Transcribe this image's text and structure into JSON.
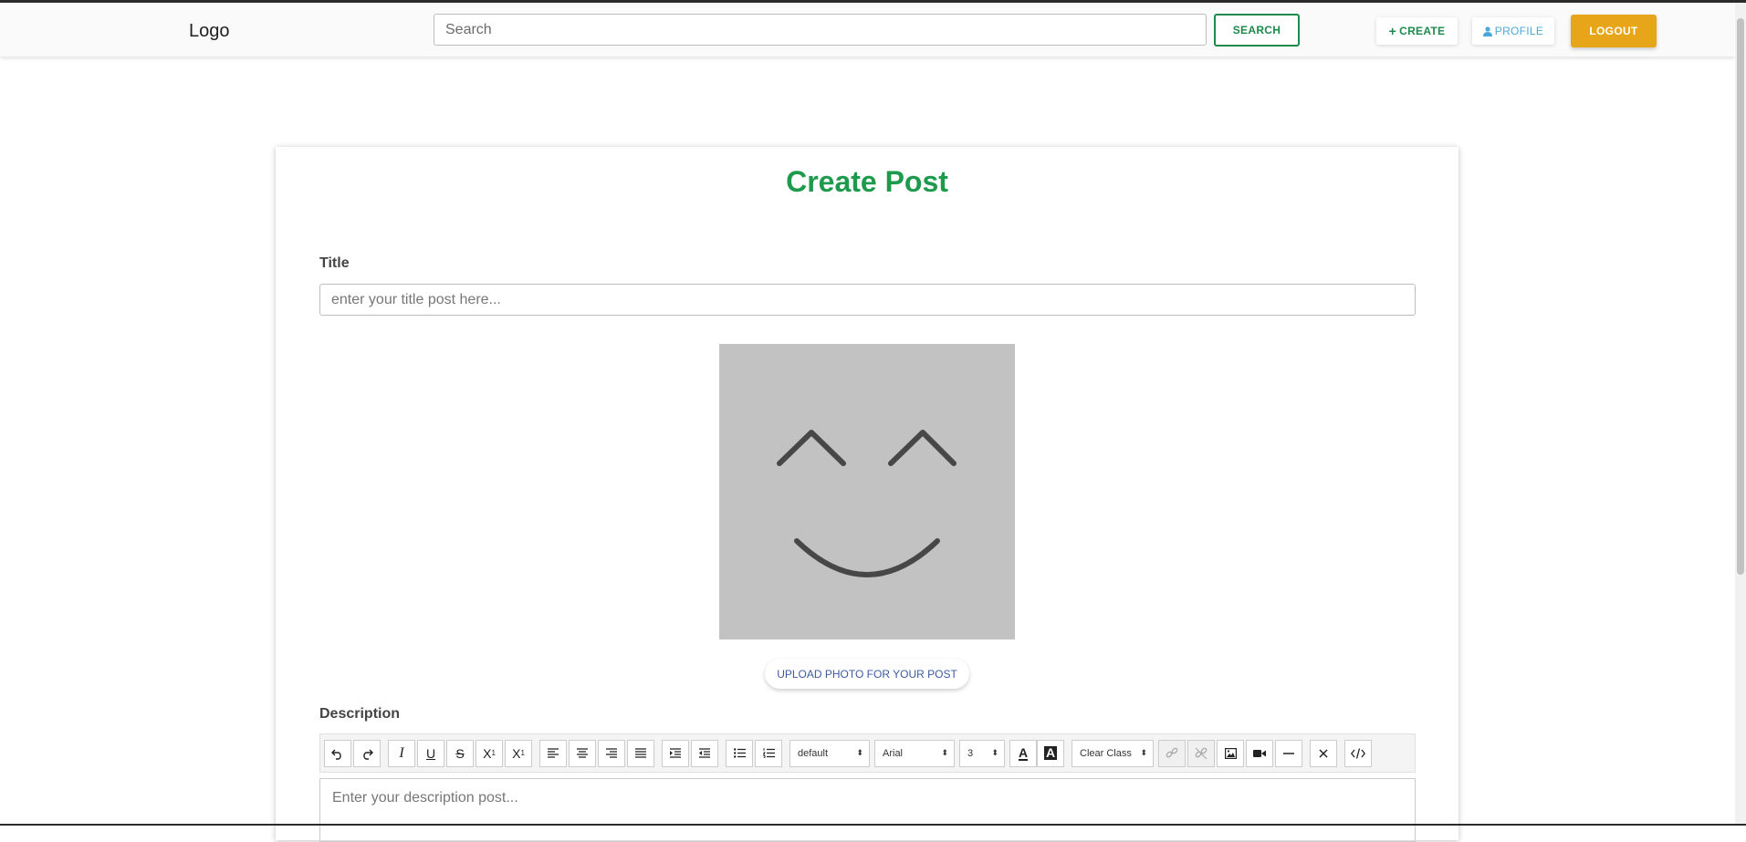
{
  "nav": {
    "logo": "Logo",
    "search_placeholder": "Search",
    "search_button": "SEARCH",
    "create_button": "CREATE",
    "profile_button": "PROFILE",
    "logout_button": "LOGOUT"
  },
  "form": {
    "heading": "Create Post",
    "title_label": "Title",
    "title_placeholder": "enter your title post here...",
    "upload_button": "UPLOAD PHOTO FOR YOUR POST",
    "description_label": "Description",
    "description_placeholder": "Enter your description post..."
  },
  "toolbar": {
    "block_style": "default",
    "font_family": "Arial",
    "font_size": "3",
    "clear_class": "Clear Class",
    "buttons": [
      "undo-icon",
      "redo-icon",
      "italic-icon",
      "underline-icon",
      "strikethrough-icon",
      "subscript-icon",
      "superscript-icon",
      "align-left-icon",
      "align-center-icon",
      "align-right-icon",
      "justify-icon",
      "indent-icon",
      "outdent-icon",
      "bullet-list-icon",
      "numbered-list-icon",
      "text-color-icon",
      "background-color-icon",
      "link-icon",
      "unlink-icon",
      "image-icon",
      "video-icon",
      "horizontal-rule-icon",
      "remove-format-icon",
      "code-view-icon"
    ]
  },
  "colors": {
    "accent_green": "#1e9a4c",
    "logout_orange": "#e7a51a",
    "profile_blue": "#4aa8d8",
    "upload_blue": "#3d5aa0",
    "photo_placeholder": "#c2c2c2"
  }
}
